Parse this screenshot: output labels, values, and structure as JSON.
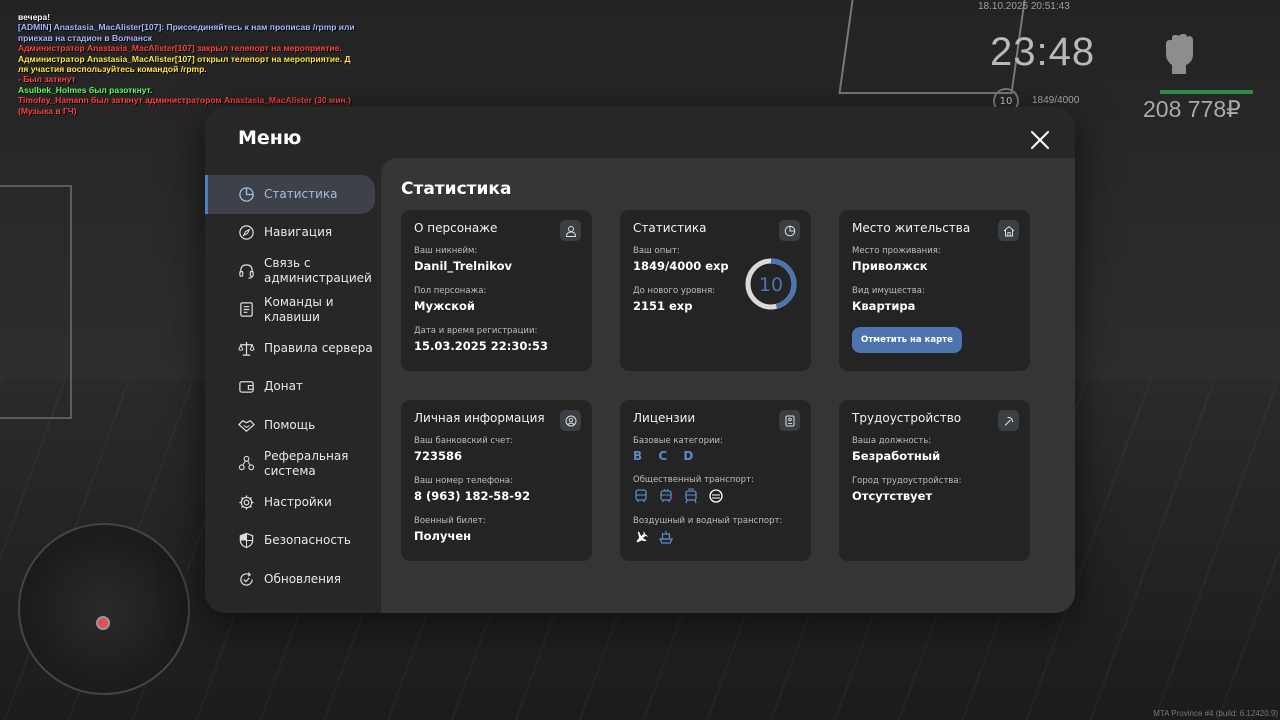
{
  "chat": [
    {
      "text": " вечера!",
      "color": "#ffffff"
    },
    {
      "text": "[ADMIN] Anastasia_MacAlister[107]: Присоединяйтесь к нам прописав /rpmp или",
      "color": "#a7b6ff"
    },
    {
      "text": "приехав на стадион в Волчанск",
      "color": "#a7b6ff"
    },
    {
      "text": "Администратор Anastasia_MacAlister[107] закрыл телепорт на мероприятие.",
      "color": "#ff4040"
    },
    {
      "text": "Администратор Anastasia_MacAlister[107] открыл телепорт на мероприятие. Д",
      "color": "#ffe640"
    },
    {
      "text": "ля участия воспользуйтесь командой /rpmp.",
      "color": "#ffe640"
    },
    {
      "text": "- Был заткнут",
      "color": "#ff4040"
    },
    {
      "text": "Asulbek_Holmes был разоткнут.",
      "color": "#5cff5c"
    },
    {
      "text": "Timofey_Hamann был заткнут администратором Anastasia_MacAlister (30 мин.)",
      "color": "#ff4040"
    },
    {
      "text": "(Музыка в ГЧ)",
      "color": "#ff4040"
    }
  ],
  "hud": {
    "datetime": "18.10.2025 20:51:43",
    "time": "23:48",
    "level": "10",
    "exp": "1849/4000",
    "money": "208 778₽",
    "build": "MTA Province #4 (build: 6.12420.9)"
  },
  "menu": {
    "title": "Меню",
    "items": [
      {
        "label": "Статистика",
        "icon": "pie-chart-icon"
      },
      {
        "label": "Навигация",
        "icon": "compass-icon"
      },
      {
        "label": "Связь с администрацией",
        "icon": "headset-icon"
      },
      {
        "label": "Команды и клавиши",
        "icon": "document-icon"
      },
      {
        "label": "Правила сервера",
        "icon": "scales-icon"
      },
      {
        "label": "Донат",
        "icon": "wallet-icon"
      },
      {
        "label": "Помощь",
        "icon": "handshake-icon"
      },
      {
        "label": "Реферальная система",
        "icon": "network-icon"
      },
      {
        "label": "Настройки",
        "icon": "gear-icon"
      },
      {
        "label": "Безопасность",
        "icon": "shield-icon"
      },
      {
        "label": "Обновления",
        "icon": "refresh-check-icon"
      }
    ]
  },
  "content": {
    "title": "Статистика",
    "character": {
      "title": "О персонаже",
      "nickname_label": "Ваш никнейм:",
      "nickname": "Danil_Trelnikov",
      "gender_label": "Пол персонажа:",
      "gender": "Мужской",
      "reg_label": "Дата и время регистрации:",
      "reg": "15.03.2025 22:30:53"
    },
    "stats": {
      "title": "Статистика",
      "exp_label": "Ваш опыт:",
      "exp": "1849/4000 exp",
      "next_label": "До нового уровня:",
      "next": "2151 exp",
      "level": "10",
      "progress": 0.462,
      "accent": "#4d74ae"
    },
    "residence": {
      "title": "Место жительства",
      "place_label": "Место проживания:",
      "place": "Приволжск",
      "property_label": "Вид имущества:",
      "property": "Квартира",
      "map_button": "Отметить на карте"
    },
    "personal": {
      "title": "Личная информация",
      "bank_label": "Ваш банковский счет:",
      "bank": "723586",
      "phone_label": "Ваш номер телефона:",
      "phone": "8 (963) 182-58-92",
      "military_label": "Военный билет:",
      "military": "Получен"
    },
    "licenses": {
      "title": "Лицензии",
      "base_label": "Базовые категории:",
      "categories": [
        "B",
        "C",
        "D"
      ],
      "public_label": "Общественный транспорт:",
      "air_label": "Воздушный и водный транспорт:"
    },
    "job": {
      "title": "Трудоустройство",
      "position_label": "Ваша должность:",
      "position": "Безработный",
      "city_label": "Город трудоустройства:",
      "city": "Отсутствует"
    }
  }
}
